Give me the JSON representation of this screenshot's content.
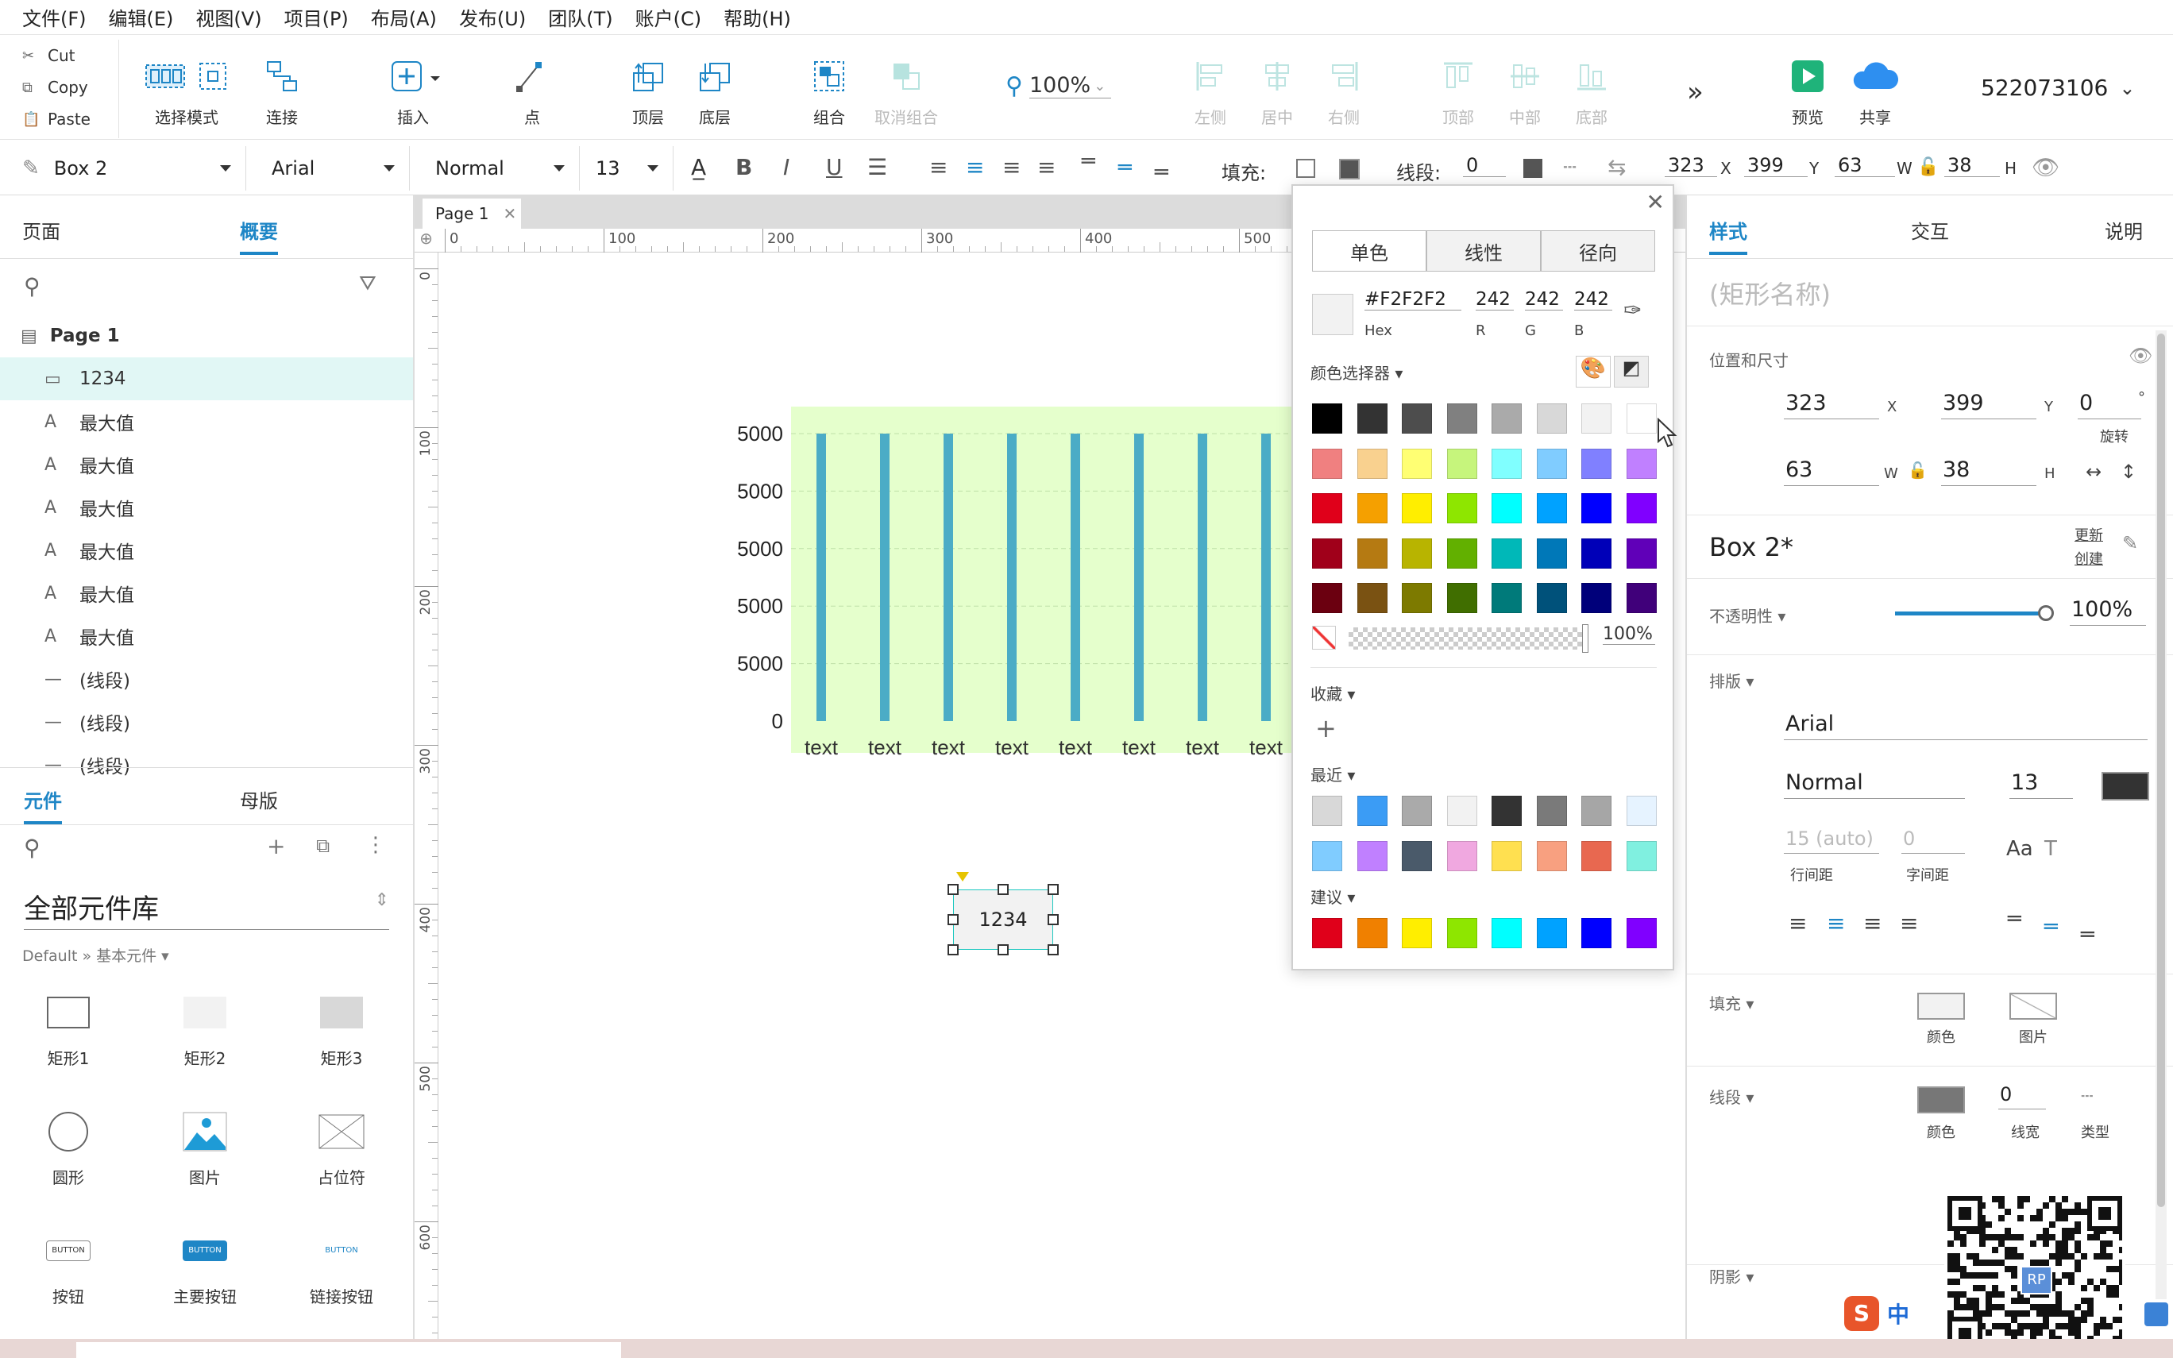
{
  "menu": [
    "文件(F)",
    "编辑(E)",
    "视图(V)",
    "项目(P)",
    "布局(A)",
    "发布(U)",
    "团队(T)",
    "账户(C)",
    "帮助(H)"
  ],
  "clipboard": {
    "cut": "Cut",
    "copy": "Copy",
    "paste": "Paste"
  },
  "toolbar": {
    "select_mode": "选择模式",
    "connect": "连接",
    "insert": "插入",
    "point": "点",
    "top_layer": "顶层",
    "bottom_layer": "底层",
    "group": "组合",
    "ungroup": "取消组合",
    "zoom": "100%",
    "align_left": "左侧",
    "align_center": "居中",
    "align_right": "右侧",
    "align_top": "顶部",
    "align_middle": "中部",
    "align_bottom": "底部",
    "preview": "预览",
    "share": "共享",
    "account": "522073106"
  },
  "format": {
    "style_name": "Box 2",
    "font": "Arial",
    "weight": "Normal",
    "size": "13",
    "fill_label": "填充:",
    "line_label": "线段:",
    "line_value": "0",
    "x": "323",
    "x_label": "X",
    "y": "399",
    "y_label": "Y",
    "w": "63",
    "w_label": "W",
    "h": "38",
    "h_label": "H"
  },
  "left": {
    "tabs": {
      "pages": "页面",
      "outline": "概要"
    },
    "page_name": "Page 1",
    "outline": [
      {
        "icon": "rect",
        "label": "1234",
        "selected": true
      },
      {
        "icon": "A",
        "label": "最大值"
      },
      {
        "icon": "A",
        "label": "最大值"
      },
      {
        "icon": "A",
        "label": "最大值"
      },
      {
        "icon": "A",
        "label": "最大值"
      },
      {
        "icon": "A",
        "label": "最大值"
      },
      {
        "icon": "A",
        "label": "最大值"
      },
      {
        "icon": "line",
        "label": "(线段)"
      },
      {
        "icon": "line",
        "label": "(线段)"
      },
      {
        "icon": "line",
        "label": "(线段)"
      }
    ],
    "lib_tabs": {
      "widgets": "元件",
      "masters": "母版"
    },
    "library": "全部元件库",
    "library_path": "Default » 基本元件 ▾",
    "widgets": [
      {
        "name": "rect1",
        "label": "矩形1"
      },
      {
        "name": "rect2",
        "label": "矩形2"
      },
      {
        "name": "rect3",
        "label": "矩形3"
      },
      {
        "name": "circle",
        "label": "圆形"
      },
      {
        "name": "image",
        "label": "图片"
      },
      {
        "name": "placeholder",
        "label": "占位符"
      },
      {
        "name": "button",
        "label": "按钮",
        "text": "BUTTON"
      },
      {
        "name": "primary-button",
        "label": "主要按钮",
        "text": "BUTTON"
      },
      {
        "name": "link-button",
        "label": "链接按钮",
        "text": "BUTTON"
      }
    ]
  },
  "canvas": {
    "tab": "Page 1",
    "ruler_h": [
      "0",
      "100",
      "200",
      "300",
      "400",
      "500"
    ],
    "ruler_v": [
      "0",
      "100",
      "200",
      "300",
      "400",
      "500",
      "600"
    ],
    "box_text": "1234"
  },
  "chart_data": {
    "type": "bar",
    "categories": [
      "text",
      "text",
      "text",
      "text",
      "text",
      "text",
      "text",
      "text"
    ],
    "y_tick_labels": [
      "5000",
      "5000",
      "5000",
      "5000",
      "5000",
      "0"
    ],
    "colors": {
      "bar": "#4bacc6",
      "background": "#e5ffcc"
    }
  },
  "picker": {
    "tabs": [
      "单色",
      "线性",
      "径向"
    ],
    "hex": "#F2F2F2",
    "hex_label": "Hex",
    "r": "242",
    "g": "242",
    "b": "242",
    "r_label": "R",
    "g_label": "G",
    "b_label": "B",
    "selector_label": "颜色选择器 ▾",
    "palette": [
      [
        "#000000",
        "#333333",
        "#4d4d4d",
        "#808080",
        "#aaaaaa",
        "#d8d8d8",
        "#f2f2f2",
        "#ffffff"
      ],
      [
        "#f08080",
        "#f9d18f",
        "#ffff73",
        "#c6f57c",
        "#80ffff",
        "#80ccff",
        "#8080ff",
        "#c080ff"
      ],
      [
        "#e0001a",
        "#f5a000",
        "#ffee00",
        "#8ee600",
        "#00ffff",
        "#00a2ff",
        "#0000ff",
        "#8000ff"
      ],
      [
        "#a0001a",
        "#b57a12",
        "#b8b400",
        "#62b000",
        "#00b8b8",
        "#0078b8",
        "#0000b8",
        "#6000b8"
      ],
      [
        "#6b0010",
        "#7a5212",
        "#7d7a00",
        "#406e00",
        "#007a7a",
        "#00517a",
        "#00007a",
        "#40007a"
      ]
    ],
    "opacity": "100%",
    "favorites_label": "收藏 ▾",
    "recent_label": "最近 ▾",
    "recent": [
      [
        "#d8d8d8",
        "#3b9cf5",
        "#aaaaaa",
        "#f2f2f2",
        "#333333",
        "#7a7a7a",
        "#a6a6a6",
        "#e6f3ff"
      ],
      [
        "#80ccff",
        "#c080ff",
        "#4a5a6a",
        "#f0a8e0",
        "#ffe050",
        "#f8a080",
        "#e86850",
        "#80f0e0"
      ]
    ],
    "suggest_label": "建议 ▾",
    "suggest": [
      "#e0001a",
      "#f08000",
      "#ffee00",
      "#8ee600",
      "#00ffff",
      "#00a2ff",
      "#0000ff",
      "#8000ff"
    ]
  },
  "right": {
    "tabs": {
      "style": "样式",
      "interact": "交互",
      "notes": "说明"
    },
    "shape_name_placeholder": "(矩形名称)",
    "pos_label": "位置和尺寸",
    "x": "323",
    "y": "399",
    "rotation": "0",
    "rotation_unit": "°",
    "rotation_label": "旋转",
    "w": "63",
    "h": "38",
    "x_label": "X",
    "y_label": "Y",
    "w_label": "W",
    "h_label": "H",
    "style_name": "Box 2*",
    "update": "更新",
    "create": "创建",
    "opacity_label": "不透明性 ▾",
    "opacity": "100%",
    "typography_label": "排版 ▾",
    "font": "Arial",
    "weight": "Normal",
    "size": "13",
    "line_height": "15 (auto)",
    "letter_spacing": "0",
    "line_height_label": "行间距",
    "letter_spacing_label": "字间距",
    "fill_label": "填充 ▾",
    "fill_color": "颜色",
    "fill_image": "图片",
    "border_label": "线段 ▾",
    "border_color": "颜色",
    "border_width": "0",
    "border_width_label": "线宽",
    "border_type": "类型",
    "shadow_label": "阴影 ▾"
  },
  "ime": {
    "lang": "中"
  },
  "qr": {
    "badge": "RP"
  }
}
